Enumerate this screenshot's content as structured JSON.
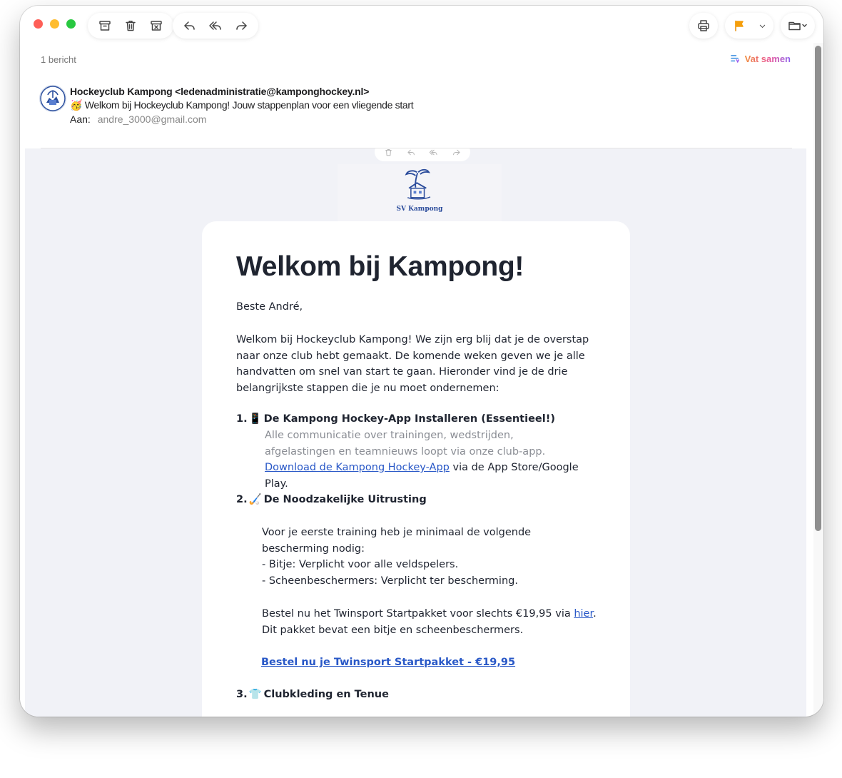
{
  "toolbar": {
    "left_icons": [
      "archive-icon",
      "trash-icon",
      "junk-icon"
    ],
    "reply_icons": [
      "reply-icon",
      "reply-all-icon",
      "forward-icon"
    ],
    "right_icons": [
      "print-icon",
      "flag-icon",
      "chevron-down-icon",
      "folder-icon"
    ],
    "flag_color": "#f59e0b"
  },
  "header": {
    "message_count": "1 bericht",
    "summarize_label": "Vat samen",
    "sender": "Hockeyclub Kampong <ledenadministratie@kamponghockey.nl>",
    "subject_emoji": "🥳",
    "subject": "Welkom bij Hockeyclub Kampong! Jouw stappenplan voor een vliegende start",
    "to_label": "Aan:",
    "to_address": "andre_3000@gmail.com"
  },
  "email": {
    "logo_caption": "SV Kampong",
    "heading": "Welkom bij Kampong!",
    "greeting": "Beste André,",
    "intro": "Welkom bij Hockeyclub Kampong! We zijn erg blij dat je de overstap naar onze club hebt gemaakt. De komende weken geven we je alle handvatten om snel van start te gaan. Hieronder vind je de drie belangrijkste stappen die je nu moet ondernemen:",
    "step1": {
      "number": "1.",
      "emoji": "📱",
      "title": "De Kampong Hockey-App Installeren (Essentieel!)",
      "description": "Alle communicatie over trainingen, wedstrijden, afgelastingen en teamnieuws loopt via onze club-app.",
      "link_text": "Download de Kampong Hockey-App",
      "after_link": " via de App Store/Google Play."
    },
    "step2": {
      "number": "2.",
      "emoji": "🏑",
      "title": "De Noodzakelijke Uitrusting",
      "intro": "Voor je eerste training heb je minimaal de volgende bescherming nodig:",
      "item1": "- Bitje: Verplicht voor alle veldspelers.",
      "item2": "- Scheenbeschermers: Verplicht ter bescherming.",
      "order_before": "Bestel nu het Twinsport Startpakket voor slechts €19,95 via ",
      "order_link": "hier",
      "order_after": ". Dit pakket bevat een bitje en scheenbeschermers.",
      "cta": "Bestel nu je Twinsport Startpakket - €19,95"
    },
    "step3": {
      "number": "3.",
      "emoji": "👕",
      "title": "Clubkleding en Tenue"
    }
  }
}
